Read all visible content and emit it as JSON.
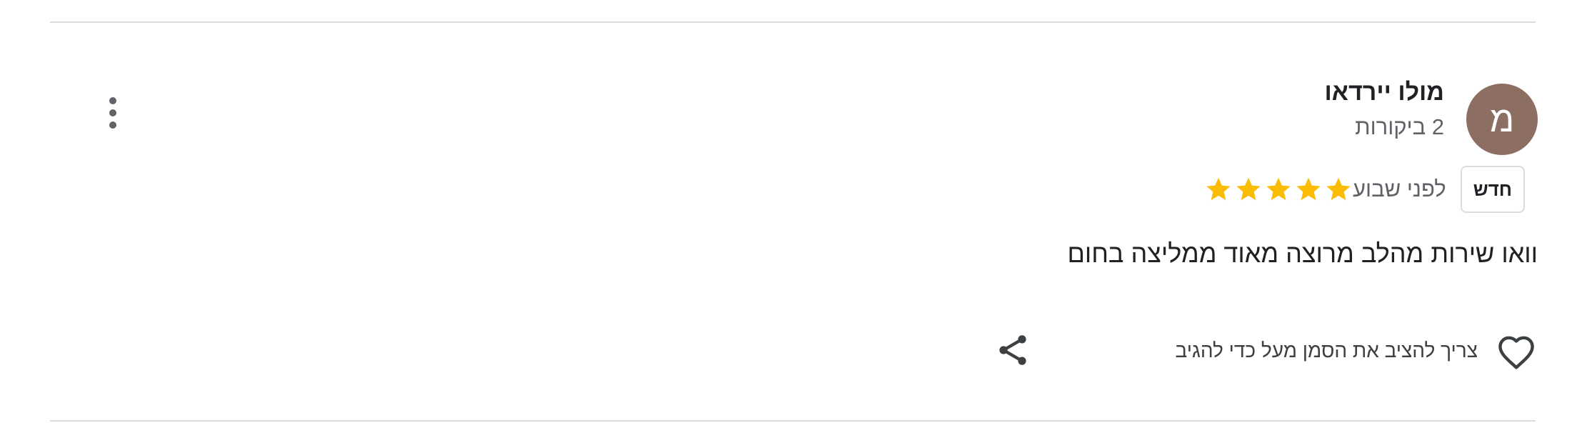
{
  "review": {
    "avatar_letter": "מ",
    "avatar_color": "#8d6e63",
    "reviewer_name": "מולו יירדאו",
    "review_count": "2 ביקורות",
    "rating": 5,
    "rating_max": 5,
    "star_color": "#fbbc04",
    "time_ago": "לפני שבוע",
    "new_badge": "חדש",
    "text": "וואו שירות מהלב מרוצה מאוד ממליצה בחום"
  },
  "actions": {
    "like_label": "צריך להציב את הסמן מעל כדי להגיב",
    "like_icon": "heart-outline-icon",
    "share_icon": "share-icon",
    "menu_icon": "more-vert-icon"
  }
}
